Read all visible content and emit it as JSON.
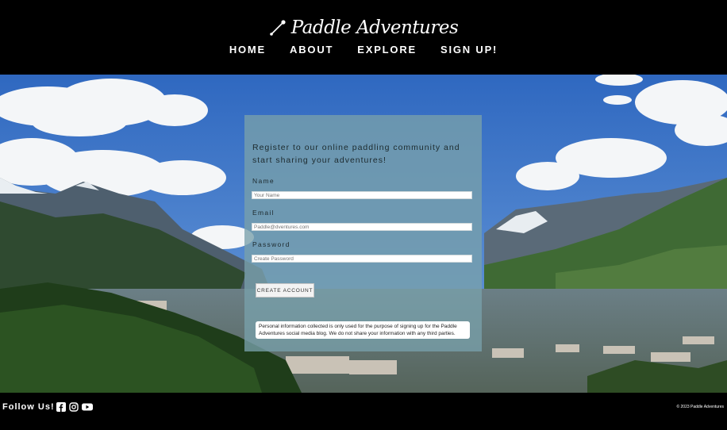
{
  "header": {
    "brand": "Paddle Adventures",
    "logo_icon": "paddle-icon",
    "nav": [
      {
        "label": "HOME"
      },
      {
        "label": "ABOUT"
      },
      {
        "label": "EXPLORE"
      },
      {
        "label": "SIGN UP!"
      }
    ]
  },
  "form": {
    "heading": "Register to our online paddling community and start sharing your adventures!",
    "name_label": "Name",
    "name_placeholder": "Your Name",
    "email_label": "Email",
    "email_placeholder": "Paddle@dventures.com",
    "password_label": "Password",
    "password_placeholder": "Create Password",
    "submit_label": "CREATE ACCOUNT",
    "notice": "Personal information collected is only used for the purpose of signing up for the Paddle Adventures social media blog. We do not share your information with any third parties."
  },
  "footer": {
    "follow": "Follow Us!",
    "social_icons": [
      "facebook-icon",
      "instagram-icon",
      "youtube-icon"
    ],
    "copyright": "© 2023 Paddle Adventures"
  },
  "colors": {
    "background": "#000000",
    "panel": "#78a0aa",
    "sky": "#3b74c8"
  }
}
